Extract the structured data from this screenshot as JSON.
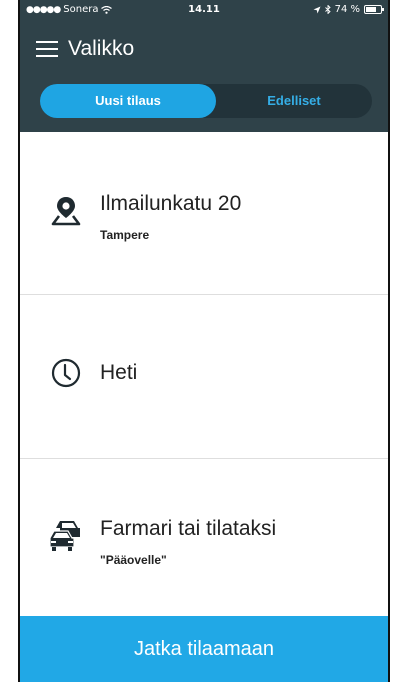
{
  "status_bar": {
    "signal": "●●●●●",
    "carrier": "Sonera",
    "time": "14.11",
    "battery": "74 %"
  },
  "header": {
    "menu_label": "Valikko",
    "tabs": [
      {
        "label": "Uusi tilaus",
        "active": true
      },
      {
        "label": "Edelliset",
        "active": false
      }
    ]
  },
  "rows": {
    "location": {
      "title": "Ilmailunkatu 20",
      "subtitle": "Tampere",
      "icon": "location-pin-icon"
    },
    "time": {
      "title": "Heti",
      "icon": "clock-icon"
    },
    "vehicle": {
      "title": "Farmari tai tilataksi",
      "subtitle": "\"Pääovelle\"",
      "icon": "cars-icon"
    }
  },
  "cta": {
    "label": "Jatka tilaamaan"
  },
  "colors": {
    "header_bg": "#2f4249",
    "accent": "#1fa5e3",
    "inactive_tab_text": "#35aee6"
  }
}
